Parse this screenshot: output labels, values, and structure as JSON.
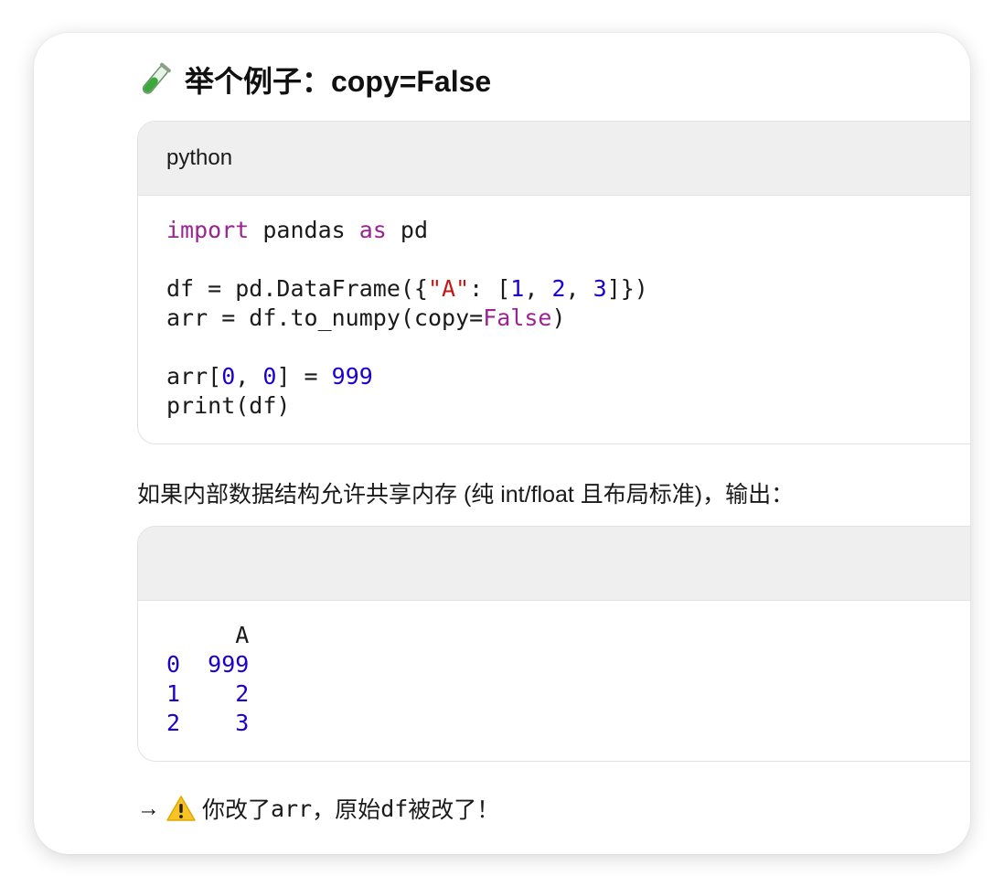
{
  "heading": {
    "icon": "test-tube-icon",
    "title": "举个例子：copy=False"
  },
  "code_block_1": {
    "language": "python",
    "lines": [
      [
        {
          "t": "import",
          "c": "kw"
        },
        {
          "t": " pandas "
        },
        {
          "t": "as",
          "c": "kw"
        },
        {
          "t": " pd"
        }
      ],
      [],
      [
        {
          "t": "df = pd.DataFrame({"
        },
        {
          "t": "\"A\"",
          "c": "str"
        },
        {
          "t": ": ["
        },
        {
          "t": "1",
          "c": "num"
        },
        {
          "t": ", "
        },
        {
          "t": "2",
          "c": "num"
        },
        {
          "t": ", "
        },
        {
          "t": "3",
          "c": "num"
        },
        {
          "t": "]})"
        }
      ],
      [
        {
          "t": "arr = df.to_numpy(copy="
        },
        {
          "t": "False",
          "c": "kw"
        },
        {
          "t": ")"
        }
      ],
      [],
      [
        {
          "t": "arr["
        },
        {
          "t": "0",
          "c": "num"
        },
        {
          "t": ", "
        },
        {
          "t": "0",
          "c": "num"
        },
        {
          "t": "] = "
        },
        {
          "t": "999",
          "c": "num"
        }
      ],
      [
        {
          "t": "print(df)"
        }
      ]
    ]
  },
  "paragraph_1": "如果内部数据结构允许共享内存 (纯 int/float 且布局标准)，输出：",
  "code_block_2": {
    "language": "",
    "lines": [
      [
        {
          "t": "     A"
        }
      ],
      [
        {
          "t": "0",
          "c": "num"
        },
        {
          "t": "  "
        },
        {
          "t": "999",
          "c": "num"
        }
      ],
      [
        {
          "t": "1",
          "c": "num"
        },
        {
          "t": "    "
        },
        {
          "t": "2",
          "c": "num"
        }
      ],
      [
        {
          "t": "2",
          "c": "num"
        },
        {
          "t": "    "
        },
        {
          "t": "3",
          "c": "num"
        }
      ]
    ]
  },
  "paragraph_2": {
    "arrow": "→",
    "icon": "warning-icon",
    "text_a": "你改了 ",
    "code_a": "arr",
    "text_b": "，原始 ",
    "code_b": "df",
    "text_c": " 被改了！"
  },
  "colors": {
    "keyword": "#9b2393",
    "number": "#1c00cf",
    "string": "#c41a16",
    "header_bg": "#efefef"
  }
}
